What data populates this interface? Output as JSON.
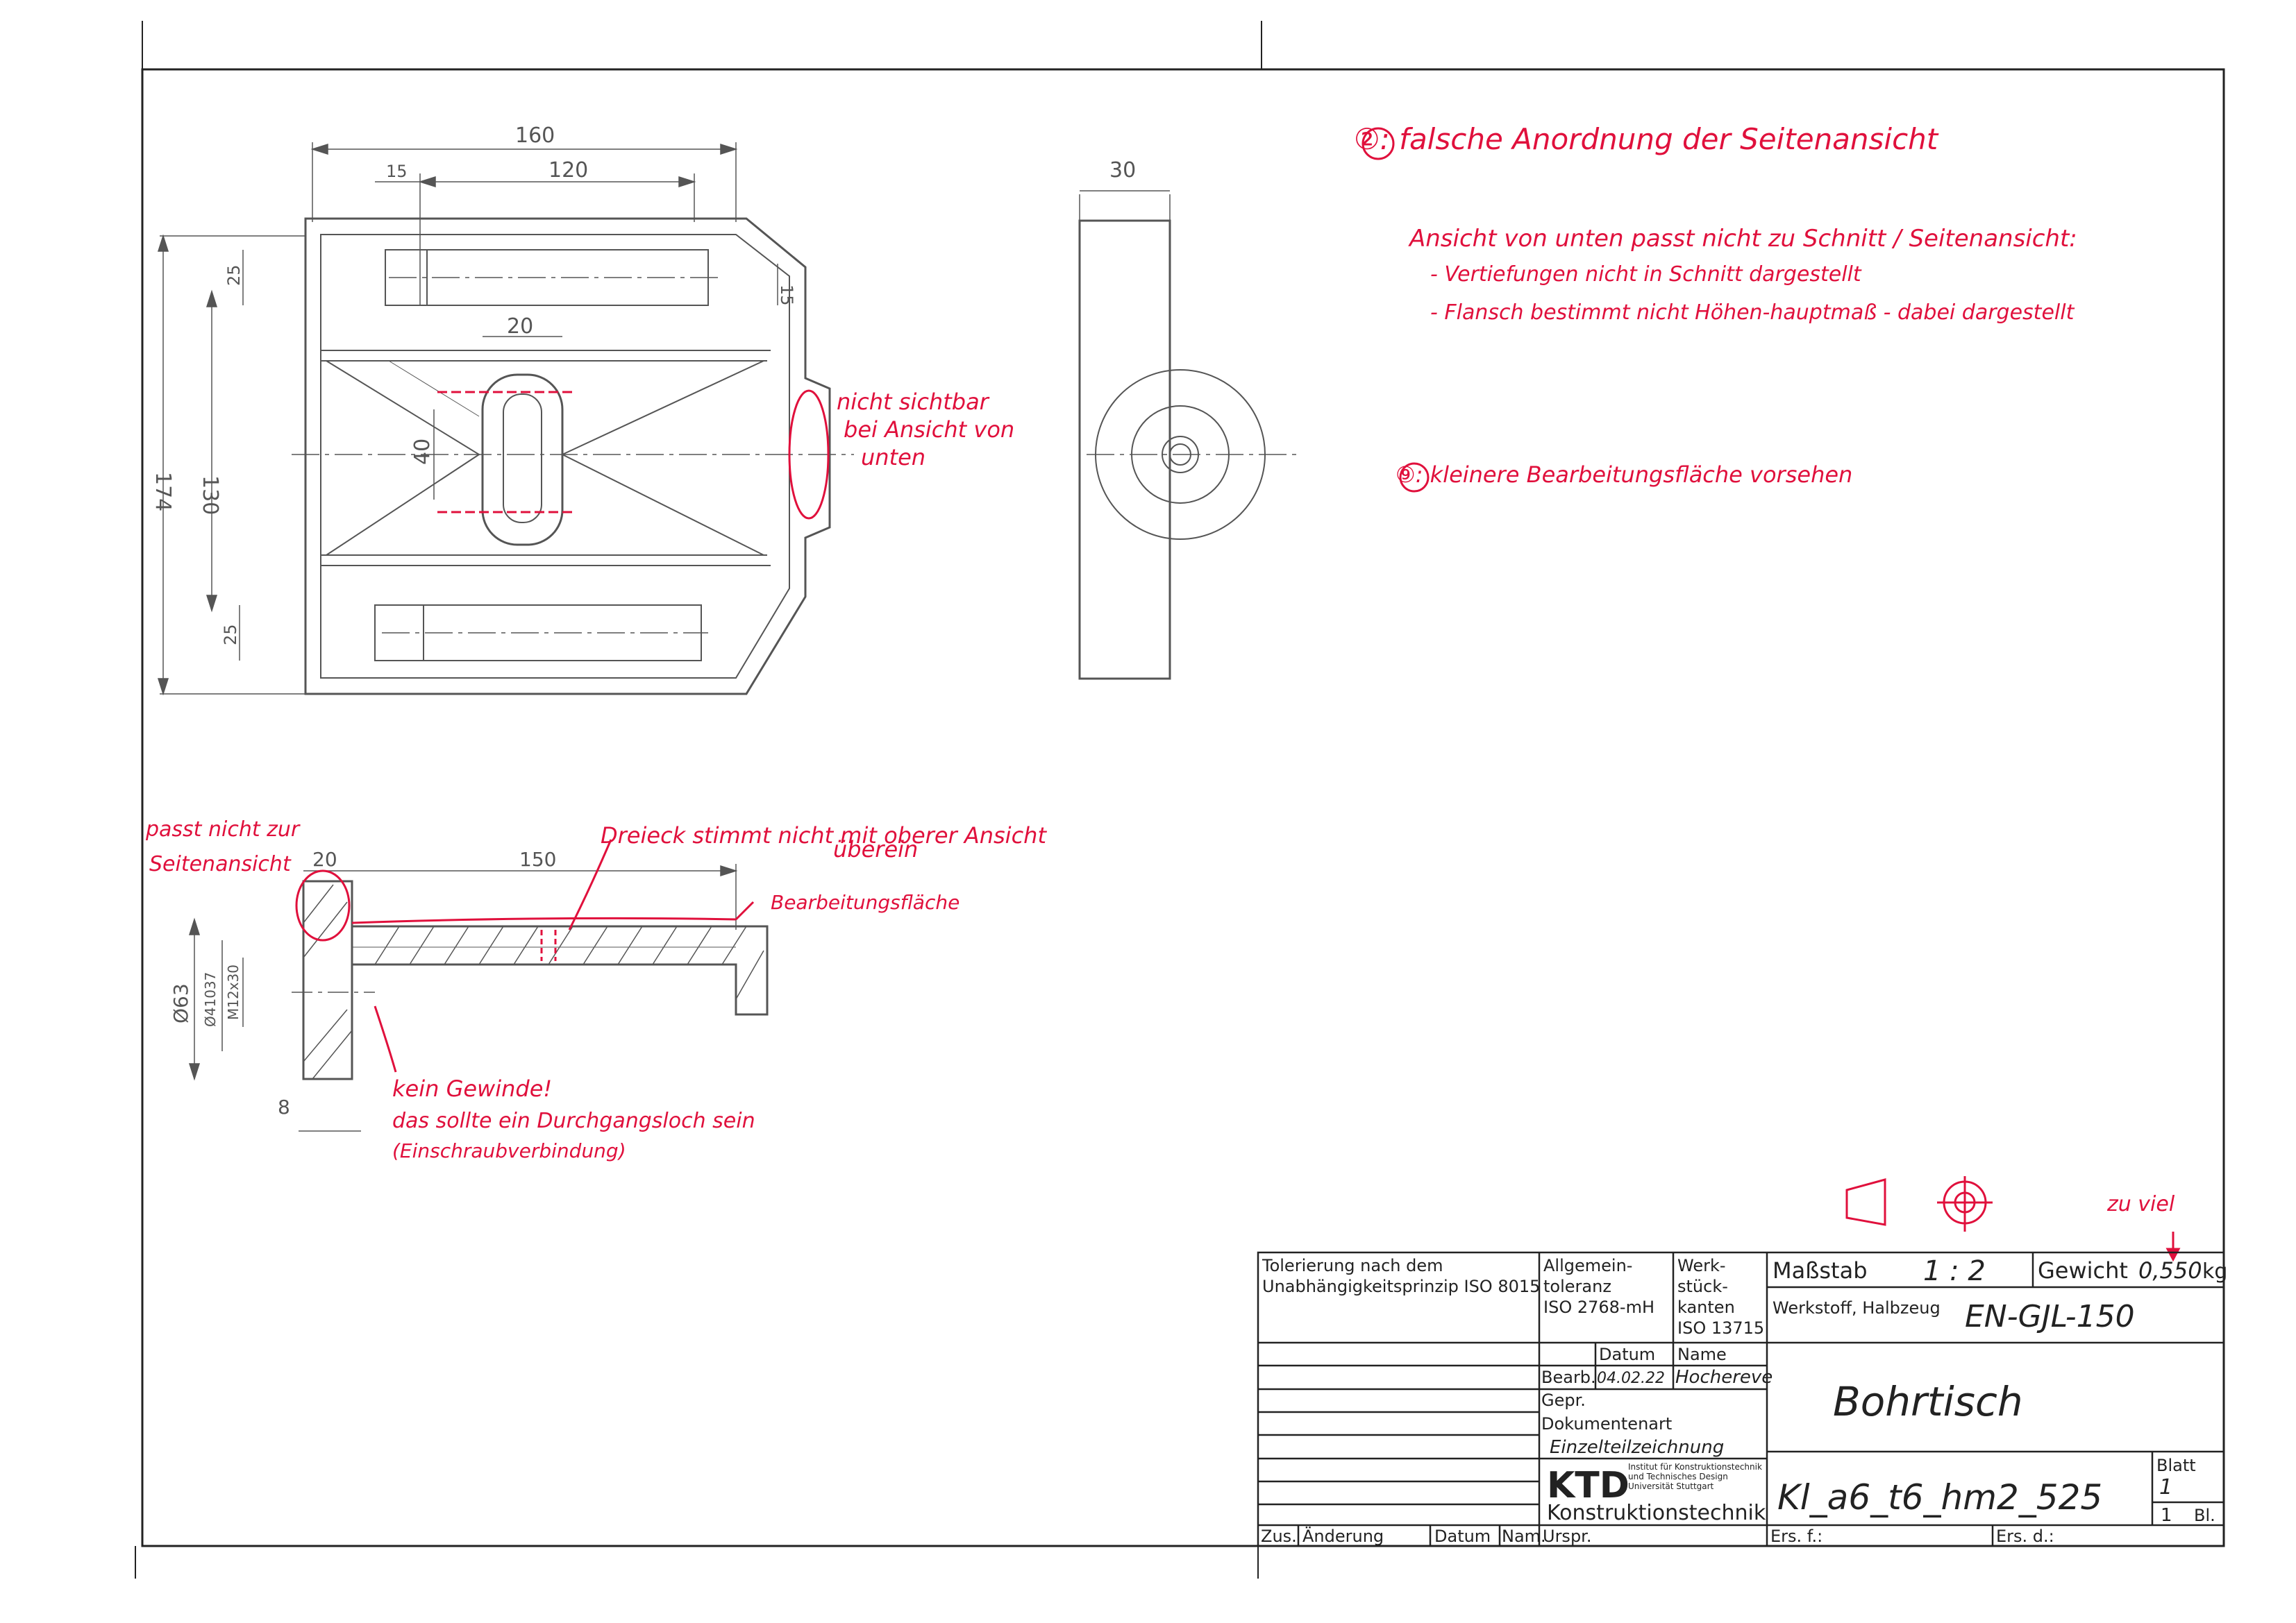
{
  "dimensions": {
    "top": {
      "overall_width": "160",
      "flange_thickness": "15",
      "inner_length": "120",
      "slot_width": "20",
      "rib_height": "25",
      "rib_height_bottom": "25",
      "web_thickness": "15",
      "slot_length": "40",
      "overall_height": "174",
      "inner_height": "130"
    },
    "side": {
      "width": "30"
    },
    "section": {
      "flange": "20",
      "length": "150",
      "outer_dia": "Ø63",
      "pcd": "Ø41037",
      "bore": "M12x30",
      "thickness": "8"
    }
  },
  "annotations": {
    "note2": "②: falsche Anordnung der Seitenansicht",
    "note_view": "Ansicht von unten passt nicht zu Schnitt / Seitenansicht:",
    "note_view_b1": "- Vertiefungen nicht in Schnitt dargestellt",
    "note_view_b2": "- Flansch bestimmt nicht Höhen-hauptmaß - dabei dargestellt",
    "note9": "⑨: kleinere Bearbeitungsfläche vorsehen",
    "not_visible_1": "nicht sichtbar",
    "not_visible_2": "bei Ansicht von",
    "not_visible_3": "unten",
    "side_mismatch_1": "passt nicht zur",
    "side_mismatch_2": "Seitenansicht",
    "triangle_1": "Dreieck stimmt nicht mit oberer Ansicht",
    "triangle_2": "überein",
    "surface": "Bearbeitungsfläche",
    "thread_1": "kein Gewinde!",
    "thread_2": "das sollte ein Durchgangsloch sein",
    "thread_3": "(Einschraubverbindung)",
    "zu_viel": "zu viel"
  },
  "title_block": {
    "tolerance_principle_1": "Tolerierung nach dem",
    "tolerance_principle_2": "Unabhängigkeitsprinzip ISO 8015",
    "general_tol_1": "Allgemein-",
    "general_tol_2": "toleranz",
    "general_tol_3": "ISO 2768-mH",
    "edges_1": "Werk-",
    "edges_2": "stück-",
    "edges_3": "kanten",
    "edges_4": "ISO 13715",
    "scale_label": "Maßstab",
    "scale_value": "1 : 2",
    "weight_label": "Gewicht",
    "weight_value": "0,550",
    "weight_unit": "kg",
    "material_label": "Werkstoff, Halbzeug",
    "material_value": "EN-GJL-150",
    "date_header": "Datum",
    "name_header": "Name",
    "bearb_label": "Bearb.",
    "bearb_date": "04.02.22",
    "bearb_name": "Hochereve",
    "gepr_label": "Gepr.",
    "doc_type_label": "Dokumentenart",
    "doc_type_value": "Einzelteilzeichnung",
    "title": "Bohrtisch",
    "logo_text": "KTD",
    "institute_1": "Institut für Konstruktionstechnik",
    "institute_2": "und Technisches Design",
    "institute_3": "Universität Stuttgart",
    "dept": "Konstruktionstechnik",
    "drawing_number": "Kl_a6_t6_hm2_525",
    "sheet_label": "Blatt",
    "sheet_value": "1",
    "sheets_value": "1",
    "sheets_unit": "Bl.",
    "zus": "Zus.",
    "aenderung": "Änderung",
    "datum": "Datum",
    "nam": "Nam.",
    "urspr": "Urspr.",
    "ers_f": "Ers. f.:",
    "ers_d": "Ers. d.:"
  },
  "colors": {
    "ink": "#555555",
    "correction": "#e0103c",
    "frame": "#222222"
  }
}
